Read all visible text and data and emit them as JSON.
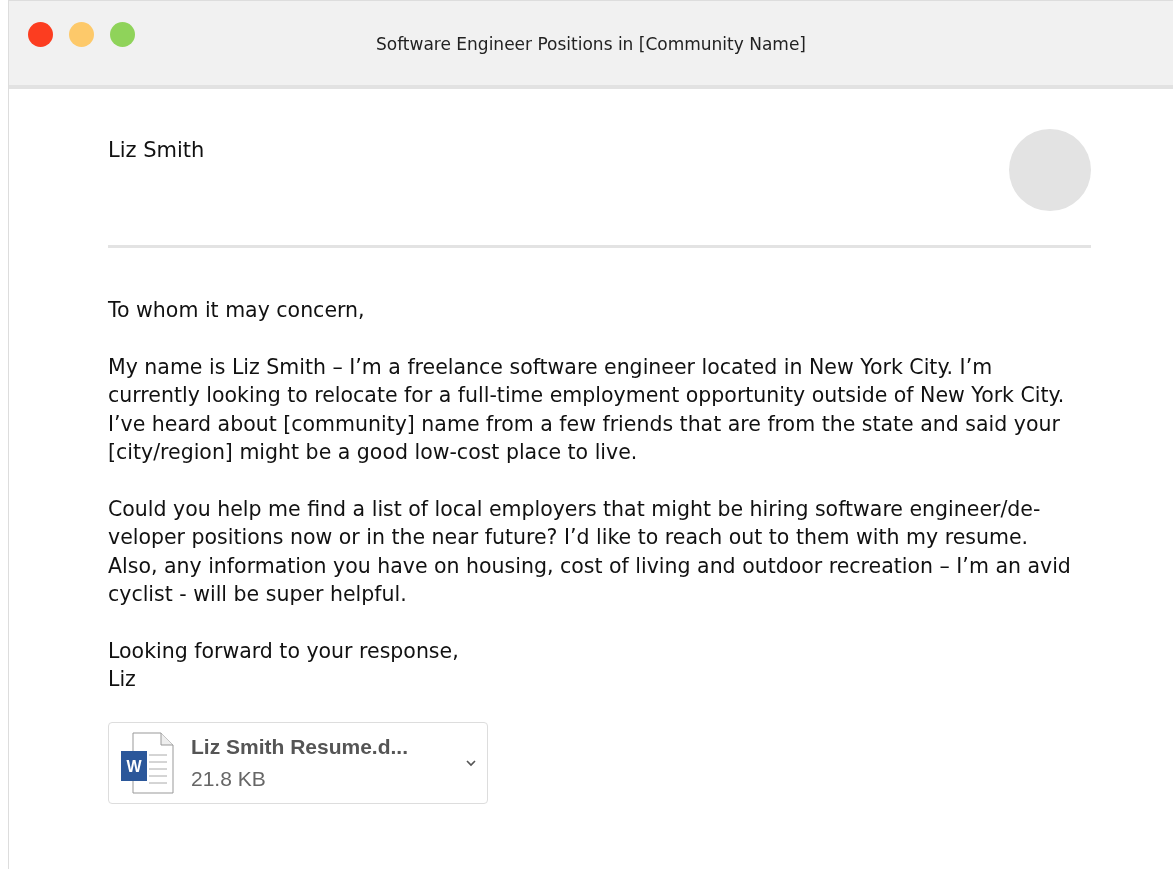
{
  "window": {
    "title": "Software Engineer Positions in [Community Name]"
  },
  "sender": {
    "name": "Liz Smith"
  },
  "body": [
    "To whom it may concern,",
    "My name is Liz Smith – I’m a freelance software engineer located in New York City. I’m currently looking to relocate for a full-time employment opportunity outside of New York City. I’ve heard about [community] name from a few friends that are from the state and said your [city/region] might be a good low-cost place to live.",
    "Could you help me find a list of local employers that might be hiring software engineer/de-veloper positions now or in the near future? I’d like to reach out to them with my resume. Also, any information you have on housing, cost of living and outdoor recreation – I’m an avid cyclist - will be super helpful.",
    "Looking forward to your response,\nLiz"
  ],
  "attachment": {
    "icon_letter": "W",
    "name": "Liz Smith Resume.d...",
    "size": "21.8 KB"
  }
}
